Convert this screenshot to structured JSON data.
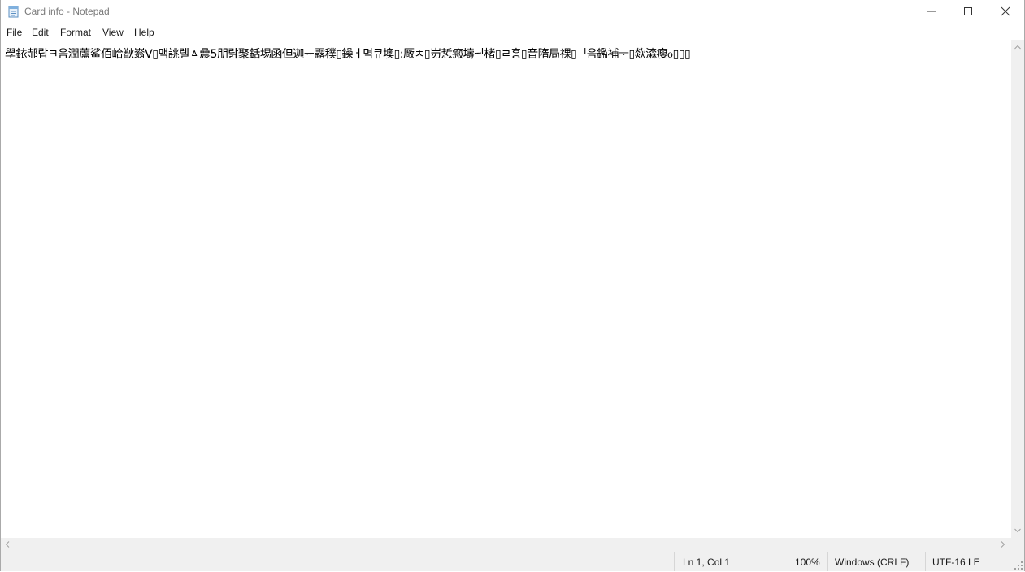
{
  "window": {
    "title": "Card info - Notepad",
    "controls": {
      "minimize": "minimize-icon",
      "maximize": "maximize-icon",
      "close": "close-icon"
    }
  },
  "menu": {
    "items": [
      {
        "label": "File"
      },
      {
        "label": "Edit"
      },
      {
        "label": "Format"
      },
      {
        "label": "View"
      },
      {
        "label": "Help"
      }
    ]
  },
  "editor": {
    "content": "學銥邿랍ㅋ음潤蘆鲨佰峆㷕嵡ᐯ▯맥誂렐ㅿ曟5朋랅聚銛埸函但迦ᅲ露穙▯鐰ㅓ멱큐墺▯:厰ㅊ▯岃悊瘢壔ᅱ楮▯ㄹ흥▯音隋局祼▯ᅵ음鑑補ᆕ▯欻潹瘦ᡃ᧐▯▯▯"
  },
  "status": {
    "position": "Ln 1, Col 1",
    "zoom": "100%",
    "line_ending": "Windows (CRLF)",
    "encoding": "UTF-16 LE"
  }
}
